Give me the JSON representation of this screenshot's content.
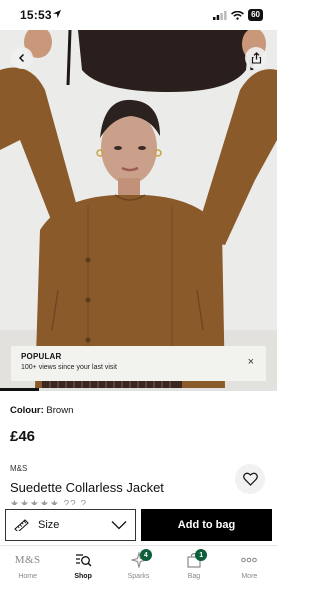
{
  "status_bar": {
    "time": "15:53",
    "battery": "60"
  },
  "toast": {
    "title": "POPULAR",
    "subtitle": "100+ views since your last visit",
    "close_glyph": "×"
  },
  "gallery": {
    "progress": 0.14
  },
  "product": {
    "colour_label": "Colour:",
    "colour_value": "Brown",
    "price": "£46",
    "brand": "M&S",
    "title": "Suedette Collarless Jacket",
    "rating_partial": "★★★★★ ?? ?"
  },
  "actions": {
    "size_label": "Size",
    "add_to_bag_label": "Add to bag"
  },
  "tab_bar": {
    "tabs": [
      {
        "label": "Home",
        "logo": "M&S"
      },
      {
        "label": "Shop"
      },
      {
        "label": "Sparks",
        "badge": "4"
      },
      {
        "label": "Bag",
        "badge": "1"
      },
      {
        "label": "More"
      }
    ],
    "active": "Shop"
  },
  "colors": {
    "jacket": "#8b5a2b",
    "badge": "#0d5e3a",
    "cta": "#000000"
  },
  "icons": [
    "location-arrow-icon",
    "signal-icon",
    "wifi-icon",
    "battery-icon",
    "back-arrow-icon",
    "share-icon",
    "close-icon",
    "heart-icon",
    "ruler-icon",
    "chevron-down-icon",
    "search-list-icon",
    "sparks-icon",
    "bag-icon",
    "more-dots-icon"
  ]
}
